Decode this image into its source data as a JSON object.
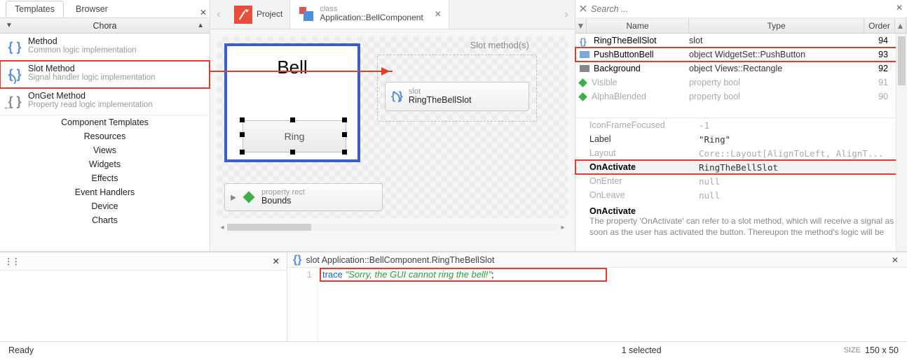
{
  "left": {
    "tabs": [
      "Templates",
      "Browser"
    ],
    "activeTab": 0,
    "choraHeader": "Chora",
    "templates": [
      {
        "title": "Method",
        "desc": "Common logic implementation",
        "kind": "method"
      },
      {
        "title": "Slot Method",
        "desc": "Signal handler logic implementation",
        "kind": "slot",
        "selected": true
      },
      {
        "title": "OnGet Method",
        "desc": "Property read logic implementation",
        "kind": "onget"
      }
    ],
    "categories": [
      "Component Templates",
      "Resources",
      "Views",
      "Widgets",
      "Effects",
      "Event Handlers",
      "Device",
      "Charts"
    ]
  },
  "center": {
    "tabs": {
      "projectLabel": "Project",
      "classKicker": "class",
      "className": "Application::BellComponent"
    },
    "component": {
      "title": "Bell",
      "buttonLabel": "Ring"
    },
    "slotGroupTitle": "Slot method(s)",
    "slotChip": {
      "kicker": "slot",
      "name": "RingTheBellSlot"
    },
    "boundsChip": {
      "kicker": "property rect",
      "name": "Bounds"
    }
  },
  "right": {
    "searchPlaceholder": "Search ...",
    "headers": {
      "name": "Name",
      "type": "Type",
      "order": "Order"
    },
    "rows": [
      {
        "name": "RingTheBellSlot",
        "type": "slot",
        "order": "94",
        "iconColor": "#5a8fd6",
        "soft": false
      },
      {
        "name": "PushButtonBell",
        "type": "object WidgetSet::PushButton",
        "order": "93",
        "iconColor": "#7aa7e0",
        "soft": false,
        "hi": true
      },
      {
        "name": "Background",
        "type": "object Views::Rectangle",
        "order": "92",
        "iconColor": "#888888",
        "soft": false
      },
      {
        "name": "Visible",
        "type": "property bool",
        "order": "91",
        "iconColor": "#3fae4a",
        "soft": true
      },
      {
        "name": "AlphaBlended",
        "type": "property bool",
        "order": "90",
        "iconColor": "#3fae4a",
        "soft": true
      }
    ],
    "props": [
      {
        "k": "IconFrameFocused",
        "v": "-1",
        "soft": true
      },
      {
        "k": "Label",
        "v": "\"Ring\"",
        "soft": false
      },
      {
        "k": "Layout",
        "v": "Core::Layout[AlignToLeft, AlignT...",
        "soft": true
      },
      {
        "k": "OnActivate",
        "v": "RingTheBellSlot",
        "bold": true,
        "hi": true
      },
      {
        "k": "OnEnter",
        "v": "null",
        "soft": true
      },
      {
        "k": "OnLeave",
        "v": "null",
        "soft": true
      }
    ],
    "help": {
      "title": "OnActivate",
      "desc": "The property 'OnActivate' can refer to a slot method, which will receive a signal as soon as the user has activated the button. Thereupon the method's logic will be"
    }
  },
  "bottom": {
    "editorTitle": "slot Application::BellComponent.RingTheBellSlot",
    "lineNo": "1",
    "kw": "trace",
    "str": "\"Sorry, the GUI cannot ring the bell!\"",
    "semi": ";"
  },
  "status": {
    "ready": "Ready",
    "selected": "1 selected",
    "sizeLabel": "SIZE",
    "sizeVal": "150 x 50"
  }
}
